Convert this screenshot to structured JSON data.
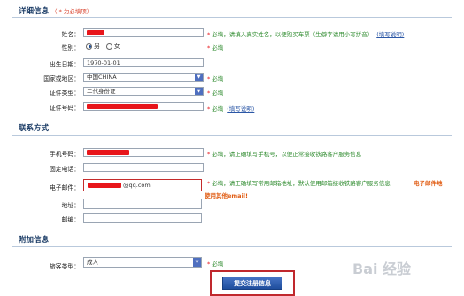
{
  "sections": {
    "details_title": "详细信息",
    "details_note": "（ * 为必填项）",
    "contact_title": "联系方式",
    "extra_title": "附加信息"
  },
  "form": {
    "name_label": "姓名：",
    "name_hint_star": "*",
    "name_hint": "必填，请填入真实姓名，以便购买车票（生僻字请用小写拼音）",
    "name_hint_link": "(填写说明)",
    "gender_label": "性别：",
    "gender_male": "男",
    "gender_female": "女",
    "gender_hint_star": "*",
    "gender_hint": "必填",
    "birth_label": "出生日期：",
    "birth_value": "1970-01-01",
    "country_label": "国家或地区：",
    "country_value": "中国CHINA",
    "country_hint_star": "*",
    "country_hint": "必填",
    "idtype_label": "证件类型：",
    "idtype_value": "二代身份证",
    "idtype_hint_star": "*",
    "idtype_hint": "必填",
    "idnum_label": "证件号码：",
    "idnum_hint_star": "*",
    "idnum_hint": "必填",
    "idnum_hint_link": "(填写说明)",
    "phone_label": "手机号码：",
    "phone_hint_star": "*",
    "phone_hint": "必填，请正确填写手机号，以便正常接收铁路客户服务信息",
    "tel_label": "固定电话：",
    "email_label": "电子邮件：",
    "email_value": "@qq.com",
    "email_hint_star": "*",
    "email_hint": "必填，请正确填写常用邮箱地址，默认使用邮箱接收铁路客户服务信息",
    "email_orange_1": "电子邮件地",
    "email_orange_2": "使用其他email!",
    "address_label": "地址：",
    "zip_label": "邮编：",
    "passenger_label": "旅客类型：",
    "passenger_value": "成人",
    "passenger_hint_star": "*",
    "passenger_hint": "必填",
    "submit_label": "提交注册信息"
  },
  "watermark": "Bai 经验",
  "colors": {
    "section_title": "#1b3c66",
    "required_note": "#d8412b",
    "hint_green": "#2e8b2e",
    "link_blue": "#2b57a6",
    "redaction": "#e8161b",
    "submit_bg": "#1f4e9d",
    "submit_highlight": "#c0282d"
  }
}
